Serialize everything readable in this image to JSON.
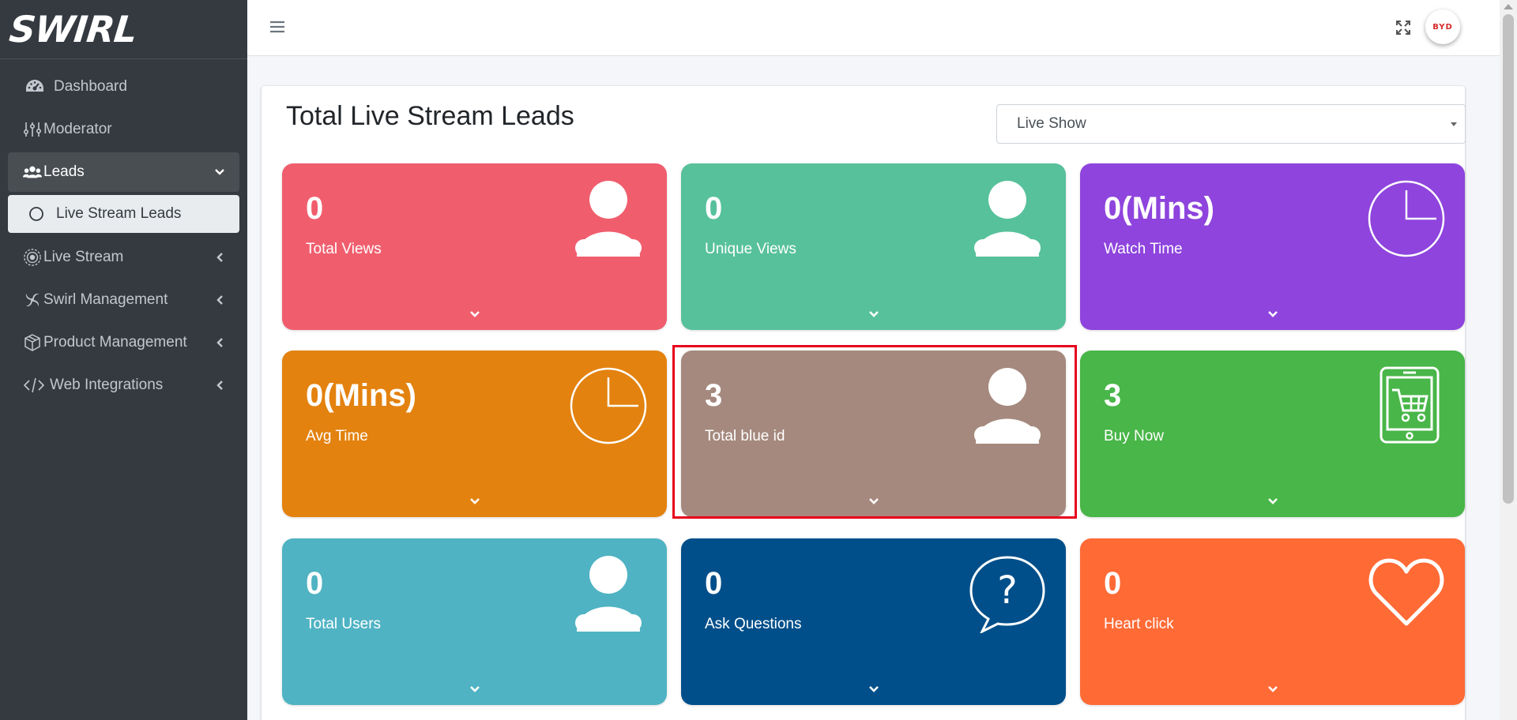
{
  "brand": {
    "name": "SWIRL"
  },
  "sidebar": {
    "items": [
      {
        "label": "Dashboard",
        "icon": "tachometer-icon"
      },
      {
        "label": "Moderator",
        "icon": "sliders-icon"
      },
      {
        "label": "Leads",
        "icon": "users-icon",
        "expanded": true
      },
      {
        "label": "Live Stream Leads",
        "icon": "circle-outline-icon",
        "active": true
      },
      {
        "label": "Live Stream",
        "icon": "broadcast-icon"
      },
      {
        "label": "Swirl Management",
        "icon": "swirl-icon"
      },
      {
        "label": "Product Management",
        "icon": "box-icon"
      },
      {
        "label": "Web Integrations",
        "icon": "code-icon"
      }
    ]
  },
  "topbar": {
    "avatar_text": "BYD"
  },
  "main": {
    "title": "Total Live Stream Leads",
    "filter": {
      "selected": "Live Show"
    }
  },
  "stats": [
    {
      "value": "0",
      "label": "Total Views",
      "color": "#f05e6e",
      "icon": "user-icon"
    },
    {
      "value": "0",
      "label": "Unique Views",
      "color": "#57c19c",
      "icon": "user-icon"
    },
    {
      "value": "0(Mins)",
      "label": "Watch Time",
      "color": "#8e44dd",
      "icon": "clock-icon"
    },
    {
      "value": "0(Mins)",
      "label": "Avg Time",
      "color": "#e3820f",
      "icon": "clock-icon"
    },
    {
      "value": "3",
      "label": "Total blue id",
      "color": "#a5897e",
      "icon": "user-icon"
    },
    {
      "value": "3",
      "label": "Buy Now",
      "color": "#48b648",
      "icon": "tablet-cart-icon"
    },
    {
      "value": "0",
      "label": "Total Users",
      "color": "#4fb3c3",
      "icon": "user-icon"
    },
    {
      "value": "0",
      "label": "Ask Questions",
      "color": "#004f8a",
      "icon": "question-bubble-icon"
    },
    {
      "value": "0",
      "label": "Heart click",
      "color": "#ff6a35",
      "icon": "heart-icon"
    }
  ]
}
